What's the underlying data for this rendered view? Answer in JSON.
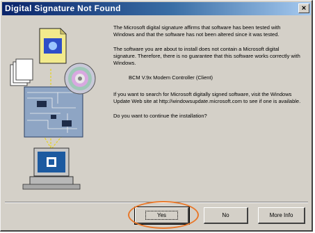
{
  "dialog": {
    "title": "Digital Signature Not Found",
    "close_glyph": "×"
  },
  "message": {
    "para1": "The Microsoft digital signature affirms that software has been tested with Windows and that the software has not been altered since it was tested.",
    "para2": "The software you are about to install does not contain a Microsoft digital signature. Therefore, there is no guarantee that this software works correctly with Windows.",
    "driver_name": "BCM V.9x Modem Controller (Client)",
    "para3": "If you want to search for Microsoft digitally signed software, visit the Windows Update Web site at http://windowsupdate.microsoft.com to see if one is available.",
    "question": "Do you want to continue the installation?"
  },
  "buttons": {
    "yes": "Yes",
    "no": "No",
    "help": "More Info"
  },
  "icons": {
    "certificate": "certificate-icon",
    "disk": "cd-disk-icon",
    "computer": "computer-icon",
    "close": "close-icon"
  },
  "colors": {
    "titlebar_start": "#0a246a",
    "titlebar_end": "#a6caf0",
    "face": "#d4d0c8",
    "highlight": "#e8782a"
  }
}
